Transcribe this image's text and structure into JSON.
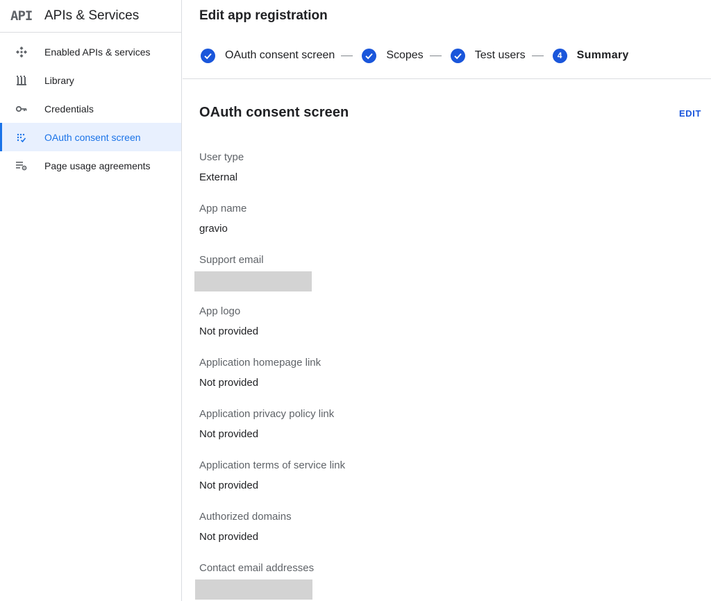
{
  "sidebar": {
    "logo": "API",
    "title": "APIs & Services",
    "items": [
      {
        "label": "Enabled APIs & services",
        "icon": "enabled-apis-icon"
      },
      {
        "label": "Library",
        "icon": "library-icon"
      },
      {
        "label": "Credentials",
        "icon": "key-icon"
      },
      {
        "label": "OAuth consent screen",
        "icon": "consent-screen-icon",
        "active": true
      },
      {
        "label": "Page usage agreements",
        "icon": "settings-list-icon"
      }
    ]
  },
  "header": {
    "title": "Edit app registration"
  },
  "stepper": {
    "steps": [
      {
        "label": "OAuth consent screen",
        "state": "done"
      },
      {
        "label": "Scopes",
        "state": "done"
      },
      {
        "label": "Test users",
        "state": "done"
      },
      {
        "label": "Summary",
        "state": "current",
        "number": "4"
      }
    ]
  },
  "section": {
    "title": "OAuth consent screen",
    "edit_label": "EDIT",
    "fields": [
      {
        "label": "User type",
        "value": "External"
      },
      {
        "label": "App name",
        "value": "gravio"
      },
      {
        "label": "Support email",
        "value": null,
        "redacted": true
      },
      {
        "label": "App logo",
        "value": "Not provided"
      },
      {
        "label": "Application homepage link",
        "value": "Not provided"
      },
      {
        "label": "Application privacy policy link",
        "value": "Not provided"
      },
      {
        "label": "Application terms of service link",
        "value": "Not provided"
      },
      {
        "label": "Authorized domains",
        "value": "Not provided"
      },
      {
        "label": "Contact email addresses",
        "value": null,
        "redacted": true
      }
    ]
  },
  "colors": {
    "accent": "#1a56db",
    "nav_active_bg": "#e8f0fe",
    "redacted": "#d3d3d3"
  }
}
